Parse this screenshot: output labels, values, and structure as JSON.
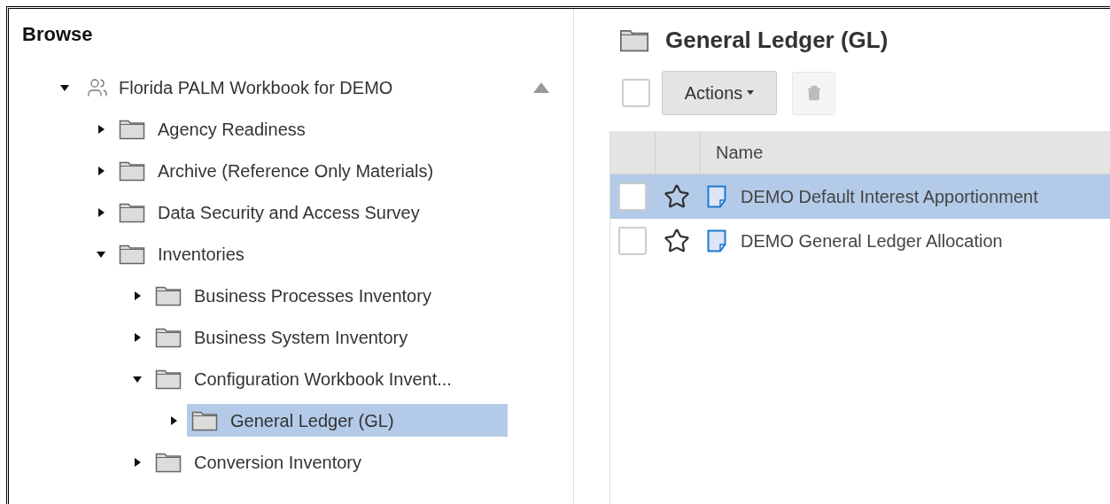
{
  "browse": {
    "title": "Browse",
    "tree": [
      {
        "label": "Florida PALM Workbook for DEMO",
        "kind": "workbook",
        "expanded": true,
        "selected": false,
        "children": [
          {
            "label": "Agency Readiness",
            "kind": "folder",
            "expanded": false,
            "selected": false
          },
          {
            "label": "Archive (Reference Only Materials)",
            "kind": "folder",
            "expanded": false,
            "selected": false
          },
          {
            "label": "Data Security and Access Survey",
            "kind": "folder",
            "expanded": false,
            "selected": false
          },
          {
            "label": "Inventories",
            "kind": "folder",
            "expanded": true,
            "selected": false,
            "children": [
              {
                "label": "Business Processes Inventory",
                "kind": "folder",
                "expanded": false,
                "selected": false
              },
              {
                "label": "Business System Inventory",
                "kind": "folder",
                "expanded": false,
                "selected": false
              },
              {
                "label": "Configuration Workbook Invent...",
                "kind": "folder",
                "expanded": true,
                "selected": false,
                "children": [
                  {
                    "label": "General Ledger (GL)",
                    "kind": "folder",
                    "expanded": false,
                    "selected": true
                  }
                ]
              },
              {
                "label": "Conversion Inventory",
                "kind": "folder",
                "expanded": false,
                "selected": false
              }
            ]
          }
        ]
      }
    ]
  },
  "content": {
    "title": "General Ledger (GL)",
    "select_all_checked": false,
    "actions_button": "Actions",
    "table": {
      "columns": [
        "Name"
      ],
      "rows": [
        {
          "name": "DEMO Default Interest Apportionment",
          "selected": true,
          "checked": false,
          "starred": false
        },
        {
          "name": "DEMO General Ledger Allocation",
          "selected": false,
          "checked": false,
          "starred": false
        }
      ]
    }
  }
}
